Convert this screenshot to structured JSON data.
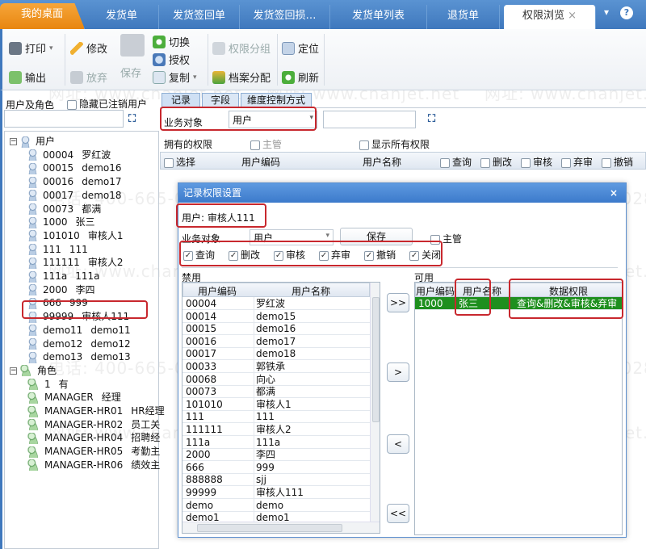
{
  "tabs": [
    {
      "label": "我的桌面"
    },
    {
      "label": "发货单"
    },
    {
      "label": "发货签回单"
    },
    {
      "label": "发货签回损…"
    },
    {
      "label": "发货单列表"
    },
    {
      "label": "退货单"
    },
    {
      "label": "权限浏览",
      "close": "×"
    }
  ],
  "tab_menu": "▾",
  "help": "?",
  "toolbar": {
    "print": "打印",
    "export": "输出",
    "edit": "修改",
    "discard": "放弃",
    "save": "保存",
    "switch": "切换",
    "authorize": "授权",
    "copy": "复制",
    "perm_group": "权限分组",
    "archive_assign": "档案分配",
    "locate": "定位",
    "refresh": "刷新",
    "dropdown": "▾"
  },
  "left": {
    "title": "用户及角色",
    "hide_cancelled": "隐藏已注销用户",
    "search_value": "",
    "users_label": "用户",
    "users": [
      {
        "code": "00004",
        "name": "罗红波"
      },
      {
        "code": "00015",
        "name": "demo16"
      },
      {
        "code": "00016",
        "name": "demo17"
      },
      {
        "code": "00017",
        "name": "demo18"
      },
      {
        "code": "00073",
        "name": "都满"
      },
      {
        "code": "1000",
        "name": "张三"
      },
      {
        "code": "101010",
        "name": "审核人1"
      },
      {
        "code": "111",
        "name": "111"
      },
      {
        "code": "111111",
        "name": "审核人2"
      },
      {
        "code": "111a",
        "name": "111a"
      },
      {
        "code": "2000",
        "name": "李四"
      },
      {
        "code": "666",
        "name": "999"
      },
      {
        "code": "99999",
        "name": "审核人111",
        "selected": true
      },
      {
        "code": "demo11",
        "name": "demo11"
      },
      {
        "code": "demo12",
        "name": "demo12"
      },
      {
        "code": "demo13",
        "name": "demo13"
      }
    ],
    "roles_label": "角色",
    "roles": [
      {
        "code": "1",
        "name": "有"
      },
      {
        "code": "MANAGER",
        "name": "经理"
      },
      {
        "code": "MANAGER-HR01",
        "name": "HR经理"
      },
      {
        "code": "MANAGER-HR02",
        "name": "员工关"
      },
      {
        "code": "MANAGER-HR04",
        "name": "招聘经"
      },
      {
        "code": "MANAGER-HR05",
        "name": "考勤主"
      },
      {
        "code": "MANAGER-HR06",
        "name": "绩效主"
      }
    ]
  },
  "main": {
    "subtabs": [
      "记录",
      "字段",
      "维度控制方式"
    ],
    "biz_label": "业务对象",
    "biz_value": "用户",
    "search_value": "",
    "owned_label": "拥有的权限",
    "supervisor": "主管",
    "show_all": "显示所有权限",
    "columns": [
      "选择",
      "用户编码",
      "用户名称",
      "查询",
      "删改",
      "审核",
      "弃审",
      "撤销"
    ]
  },
  "dialog": {
    "title": "记录权限设置",
    "close": "×",
    "user_line": "用户: 审核人111",
    "biz_label": "业务对象",
    "biz_value": "用户",
    "save": "保存",
    "supervisor": "主管",
    "perms": [
      {
        "label": "查询",
        "checked": true
      },
      {
        "label": "删改",
        "checked": true
      },
      {
        "label": "审核",
        "checked": true
      },
      {
        "label": "弃审",
        "checked": true
      },
      {
        "label": "撤销",
        "checked": true
      },
      {
        "label": "关闭",
        "checked": true
      }
    ],
    "disabled_label": "禁用",
    "enabled_label": "可用",
    "disabled_cols": [
      "用户编码",
      "用户名称"
    ],
    "disabled_rows": [
      [
        "00004",
        "罗红波"
      ],
      [
        "00014",
        "demo15"
      ],
      [
        "00015",
        "demo16"
      ],
      [
        "00016",
        "demo17"
      ],
      [
        "00017",
        "demo18"
      ],
      [
        "00033",
        "郭铁承"
      ],
      [
        "00068",
        "向心"
      ],
      [
        "00073",
        "都满"
      ],
      [
        "101010",
        "审核人1"
      ],
      [
        "111",
        "111"
      ],
      [
        "111111",
        "审核人2"
      ],
      [
        "111a",
        "111a"
      ],
      [
        "2000",
        "李四"
      ],
      [
        "666",
        "999"
      ],
      [
        "888888",
        "sjj"
      ],
      [
        "99999",
        "审核人111"
      ],
      [
        "demo",
        "demo"
      ],
      [
        "demo1",
        "demo1"
      ]
    ],
    "enabled_cols": [
      "用户编码",
      "用户名称",
      "数据权限"
    ],
    "enabled_rows": [
      [
        "1000",
        "张三",
        "查询&删改&审核&弃审"
      ]
    ],
    "move_all_right": ">>",
    "move_right": ">",
    "move_left": "<",
    "move_all_left": "<<"
  },
  "watermark": {
    "phone": "电话: 400-665-0028",
    "site": "网址: www.chanjet.net"
  },
  "colors": {
    "tabbar": "#3f78bd",
    "home_tab": "#e8860f",
    "highlight_red": "#c8282e",
    "selected_row": "#1e8f1e"
  }
}
